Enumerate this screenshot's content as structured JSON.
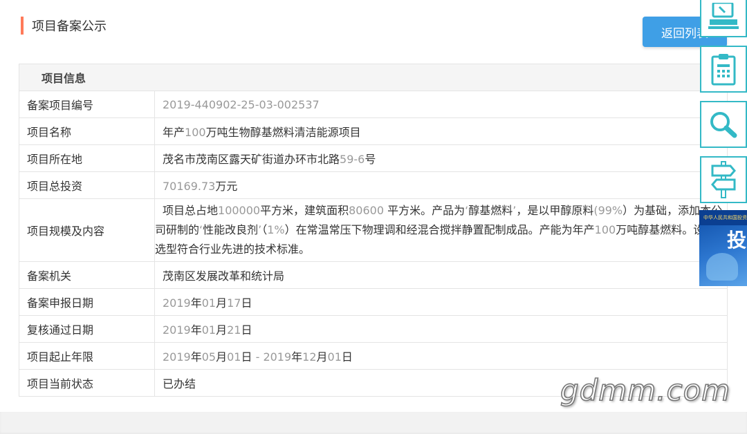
{
  "header": {
    "title": "项目备案公示"
  },
  "back_button": {
    "label": "返回列表"
  },
  "section": {
    "title": "项目信息"
  },
  "rows": {
    "code": {
      "label": "备案项目编号",
      "value": "2019-440902-25-03-002537"
    },
    "name": {
      "label": "项目名称",
      "p1": "年产",
      "p2": "100",
      "p3": "万吨生物醇基燃料清洁能源项目"
    },
    "location": {
      "label": "项目所在地",
      "p1": "茂名市茂南区露天矿街道办环市北路",
      "p2": "59-6",
      "p3": "号"
    },
    "investment": {
      "label": "项目总投资",
      "p1": "70169.73",
      "p2": "万元"
    },
    "scale": {
      "label": "项目规模及内容",
      "t1": "项目总占地",
      "t2": "100000",
      "t3": "平方米，建筑面积",
      "t4": "80600",
      "t5": " 平方米。产品为",
      "t6": "‘",
      "t7": "醇基燃料",
      "t8": "’",
      "t9": "，是以甲醇原料",
      "t10": "(99%",
      "t11": "）为基础，添加本公司研制的",
      "t12": "‘",
      "t13": "性能改良剂",
      "t14": "’",
      "t15": "（",
      "t16": "1%",
      "t17": "）在常温常压下物理调和经混合搅拌静置配制成品。产能为年产",
      "t18": "100",
      "t19": "万吨醇基燃料。设备选型符合行业先进的技术标准。"
    },
    "authority": {
      "label": "备案机关",
      "value": "茂南区发展改革和统计局"
    },
    "declare_date": {
      "label": "备案申报日期",
      "y": "2019",
      "yc": "年",
      "m": "01",
      "mc": "月",
      "d": "17",
      "dc": "日"
    },
    "approve_date": {
      "label": "复核通过日期",
      "y": "2019",
      "yc": "年",
      "m": "01",
      "mc": "月",
      "d": "21",
      "dc": "日"
    },
    "period": {
      "label": "项目起止年限",
      "y1": "2019",
      "yc1": "年",
      "m1": "05",
      "mc1": "月",
      "d1": "01",
      "dc1": "日",
      "sep": " - ",
      "y2": "2019",
      "yc2": "年",
      "m2": "12",
      "mc2": "月",
      "d2": "01",
      "dc2": "日"
    },
    "status": {
      "label": "项目当前状态",
      "value": "已办结"
    }
  },
  "side_tools": [
    {
      "icon": "computer-icon"
    },
    {
      "icon": "clipboard-icon"
    },
    {
      "icon": "search-icon"
    },
    {
      "icon": "signpost-icon"
    }
  ],
  "banner": {
    "small_text": "中华人民共和国投资项目在线审批",
    "big_char": "投"
  },
  "watermark": {
    "text": "gdmm.com"
  },
  "colors": {
    "accent_bar": "#ff7a59",
    "button": "#3f9fe6",
    "tool_border": "#33b9c6",
    "muted_text": "#999999"
  }
}
